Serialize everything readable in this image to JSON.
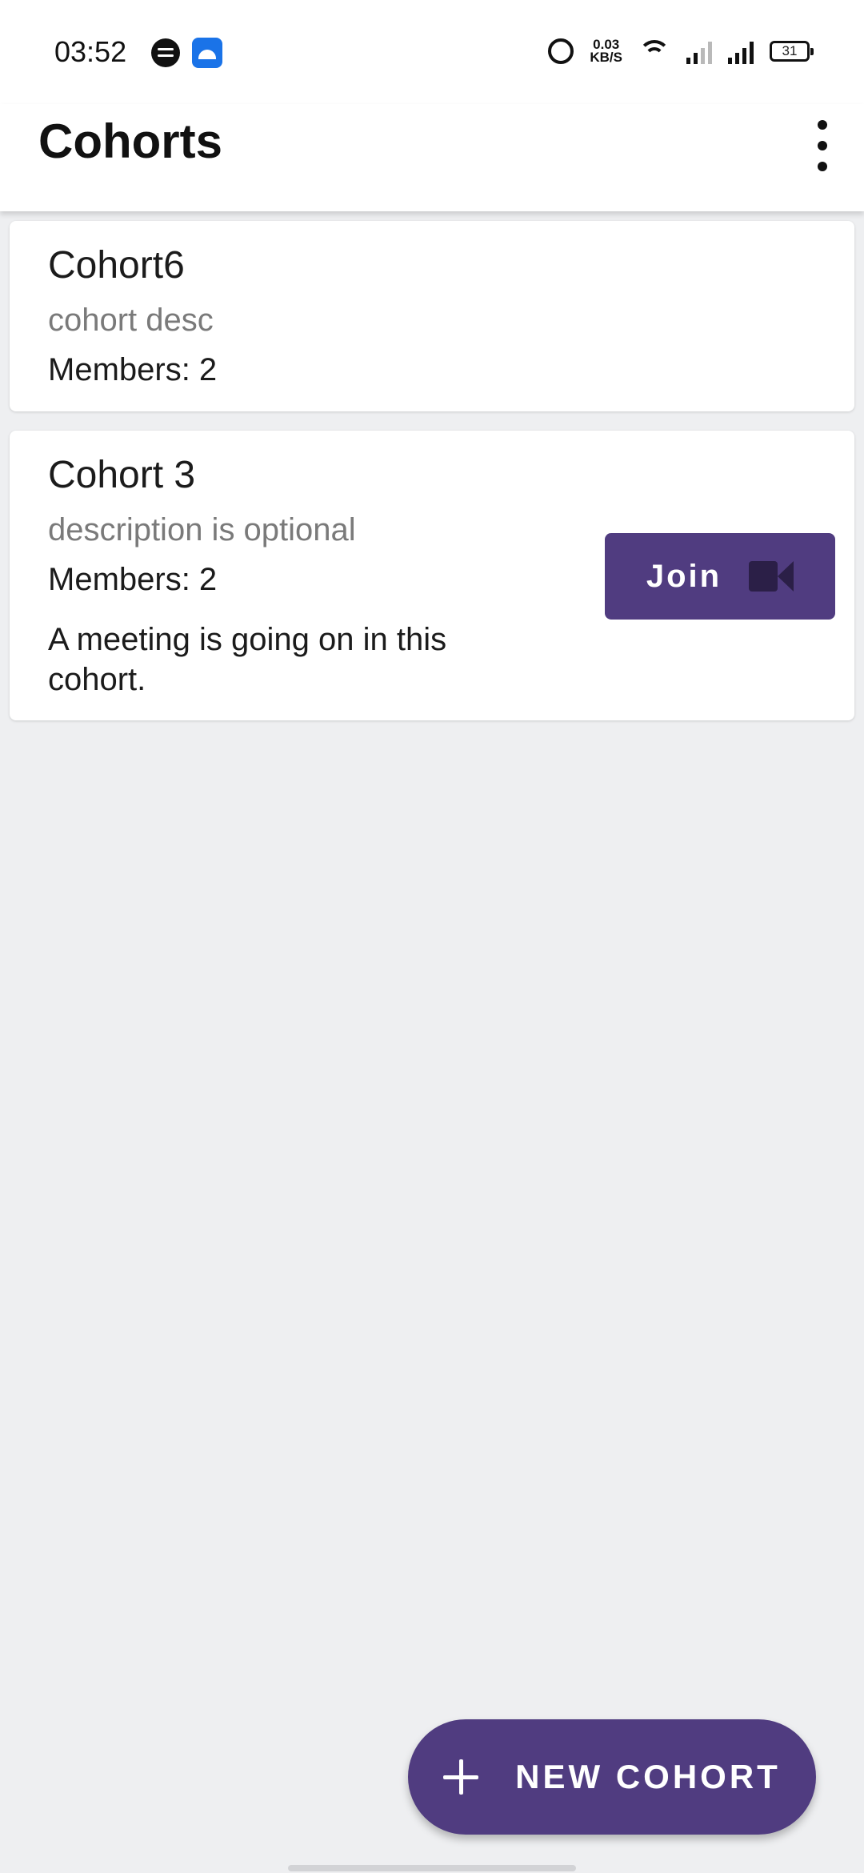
{
  "status_bar": {
    "time": "03:52",
    "speed_value": "0.03",
    "speed_unit": "KB/S",
    "battery": "31",
    "icons": [
      "spotify-icon",
      "android-notification-icon",
      "alarm-icon",
      "wifi-icon",
      "volte-icon",
      "signal-icon",
      "battery-icon"
    ]
  },
  "appbar": {
    "title": "Cohorts",
    "overflow_icon": "more-vert-icon"
  },
  "cohorts": [
    {
      "name": "Cohort6",
      "description": "cohort desc",
      "members": "Members: 2"
    },
    {
      "name": "Cohort 3",
      "description": "description is optional",
      "members": "Members: 2",
      "meeting_note": "A meeting is going on in this cohort.",
      "join_label": "Join",
      "join_icon": "videocam-icon"
    }
  ],
  "fab": {
    "label": "NEW COHORT",
    "icon": "plus-icon"
  },
  "colors": {
    "accent": "#503c80",
    "background": "#eeeff1",
    "surface": "#ffffff"
  }
}
